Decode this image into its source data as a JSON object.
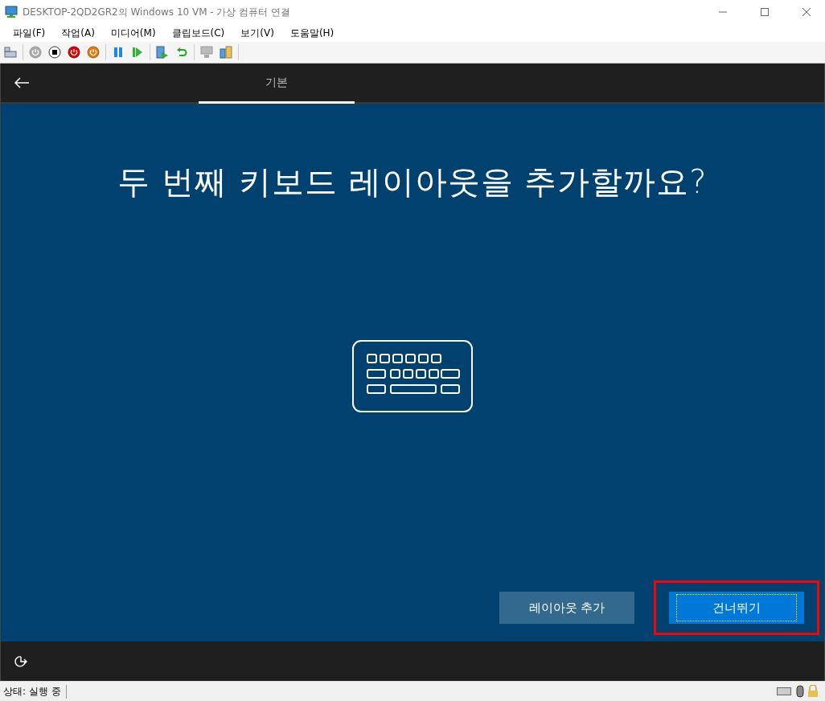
{
  "window": {
    "title": "DESKTOP-2QD2GR2의 Windows 10 VM - 가상 컴퓨터 연결"
  },
  "menu": [
    "파일(F)",
    "작업(A)",
    "미디어(M)",
    "클립보드(C)",
    "보기(V)",
    "도움말(H)"
  ],
  "tabs": [
    {
      "label": "기본",
      "selected": true
    }
  ],
  "heading": "두 번째 키보드 레이아웃을 추가할까요?",
  "buttons": [
    {
      "label": "레이아웃 추가",
      "kind": "secondary",
      "focused": false
    },
    {
      "label": "건너뛰기",
      "kind": "primary",
      "focused": true
    }
  ],
  "status_bar": {
    "text": "상태: 실행 중"
  }
}
